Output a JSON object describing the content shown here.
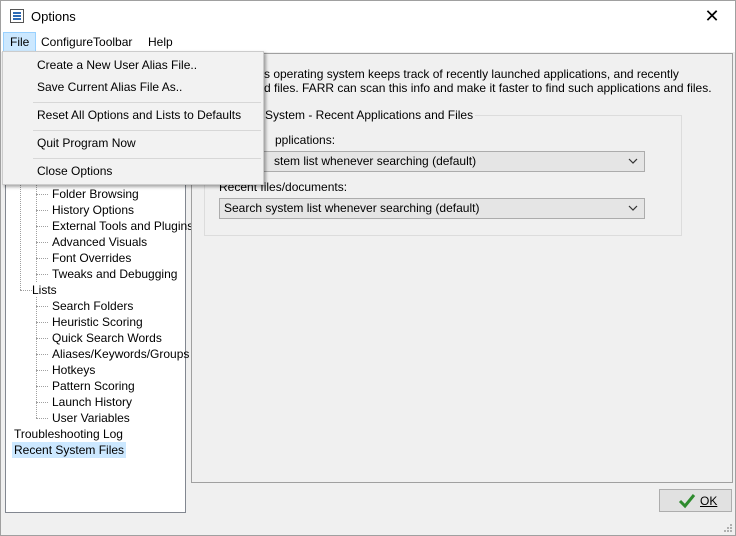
{
  "window": {
    "title": "Options",
    "close_glyph": "✕"
  },
  "menubar": {
    "items": [
      "File",
      "ConfigureToolbar",
      "Help"
    ]
  },
  "file_menu": {
    "items": [
      "Create a New User Alias File..",
      "Save Current Alias File As..",
      "Reset All Options and Lists to Defaults",
      "Quit Program Now",
      "Close Options"
    ]
  },
  "tree": {
    "items": [
      "Folder Browsing",
      "History Options",
      "External Tools and Plugins",
      "Advanced Visuals",
      "Font Overrides",
      "Tweaks and Debugging",
      "Lists",
      "Search Folders",
      "Heuristic Scoring",
      "Quick Search Words",
      "Aliases/Keywords/Groups",
      "Hotkeys",
      "Pattern Scoring",
      "Launch History",
      "User Variables",
      "Troubleshooting Log",
      "Recent System Files"
    ],
    "selected": "Recent System Files"
  },
  "content": {
    "description_line1": "s operating system keeps track of recently launched applications, and recently",
    "description_line2": "d files.  FARR can scan this info and make it faster to find such applications and files.",
    "group_title": "System - Recent Applications and Files",
    "apps_label": "pplications:",
    "apps_value": "stem list whenever searching (default)",
    "files_label": "Recent files/documents:",
    "files_value": "Search system list whenever searching (default)"
  },
  "footer": {
    "ok_label": "OK"
  },
  "colors": {
    "menu_active": "#cce8ff",
    "selected": "#cce8ff",
    "ok_check": "#2e8b2e"
  }
}
